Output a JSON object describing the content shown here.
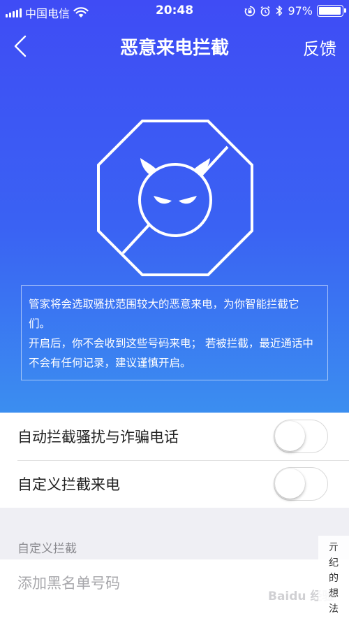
{
  "status_bar": {
    "carrier": "中国电信",
    "time": "20:48",
    "battery_percent": "97%",
    "battery_level": 0.97,
    "icons": [
      "signal-icon",
      "wifi-icon",
      "rotation-lock-icon",
      "alarm-icon",
      "bluetooth-icon",
      "battery-icon"
    ]
  },
  "nav": {
    "back_icon": "chevron-left-icon",
    "title": "恶意来电拦截",
    "feedback_label": "反馈"
  },
  "hero": {
    "emblem_icon": "devil-octagon-icon",
    "notice_line1": "管家将会选取骚扰范围较大的恶意来电，为你智能拦截它们。",
    "notice_line2": "开启后，你不会收到这些号码来电； 若被拦截，最近通话中不会有任何记录，建议谨慎开启。"
  },
  "settings": {
    "rows": [
      {
        "label": "自动拦截骚扰与诈骗电话",
        "enabled": false
      },
      {
        "label": "自定义拦截来电",
        "enabled": false
      }
    ]
  },
  "custom_block": {
    "section_label": "自定义拦截",
    "input_placeholder": "添加黑名单号码"
  },
  "colors": {
    "gradient_top": "#3f4cf5",
    "gradient_bottom": "#3b8ef0",
    "page_background": "#efeff4"
  },
  "watermark": {
    "chars": [
      "亓",
      "纪",
      "的",
      "想",
      "法"
    ],
    "baidu": "Baidu 经验"
  }
}
